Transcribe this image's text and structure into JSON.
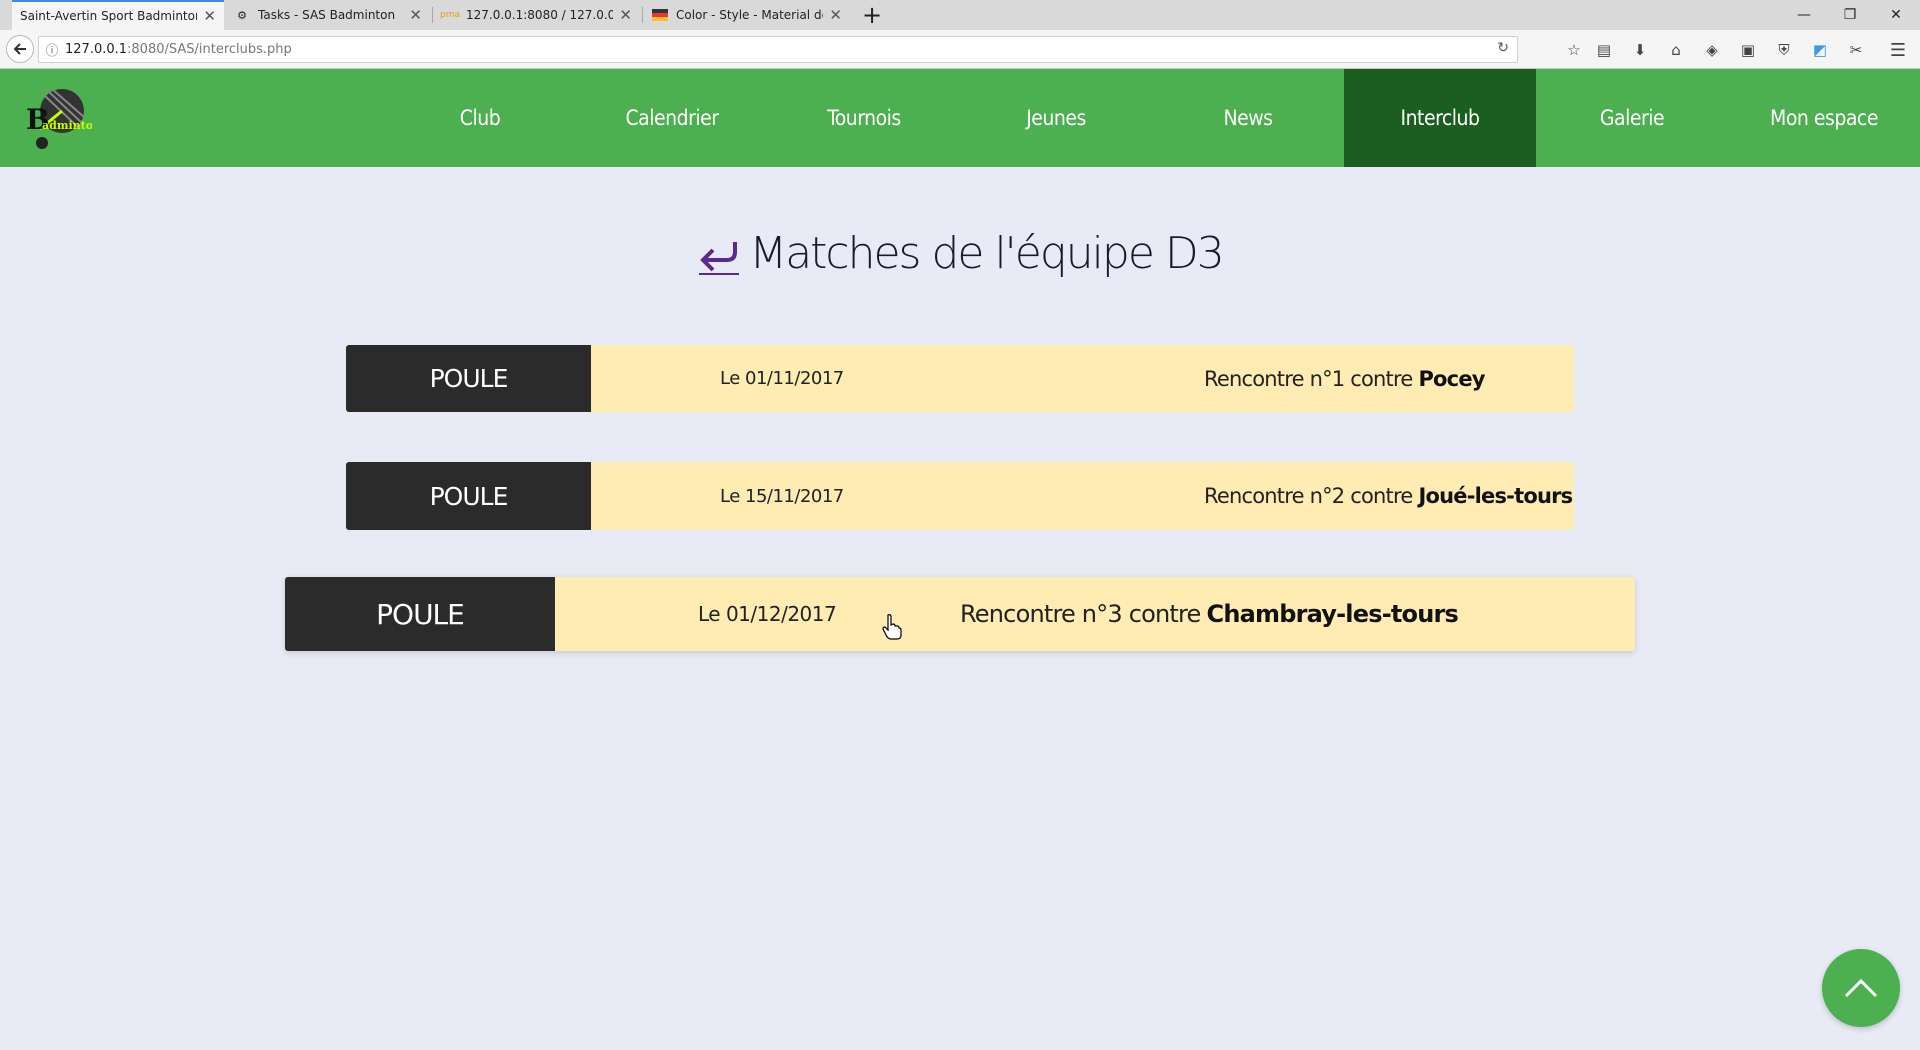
{
  "browser": {
    "tabs": [
      {
        "label": "Saint-Avertin Sport Badminton",
        "icon": "none"
      },
      {
        "label": "Tasks - SAS Badminton",
        "icon": "gear-icon"
      },
      {
        "label": "127.0.0.1:8080 / 127.0.0.1 / sa",
        "icon": "phpmyadmin-icon"
      },
      {
        "label": "Color - Style - Material desig",
        "icon": "material-icon"
      }
    ],
    "url": {
      "host": "127.0.0.1",
      "path": ":8080/SAS/interclubs.php"
    }
  },
  "nav": {
    "items": [
      "Club",
      "Calendrier",
      "Tournois",
      "Jeunes",
      "News",
      "Interclub",
      "Galerie",
      "Mon espace"
    ],
    "active": "Interclub"
  },
  "page": {
    "title": "Matches de l'équipe D3"
  },
  "matches": [
    {
      "phase": "POULE",
      "date": "Le 01/11/2017",
      "desc": "Rencontre n°1 contre",
      "opponent": "Pocey"
    },
    {
      "phase": "POULE",
      "date": "Le 15/11/2017",
      "desc": "Rencontre n°2 contre",
      "opponent": "Joué-les-tours"
    },
    {
      "phase": "POULE",
      "date": "Le 01/12/2017",
      "desc": "Rencontre n°3 contre",
      "opponent": "Chambray-les-tours"
    }
  ],
  "colors": {
    "header": "#4caf50",
    "active_nav": "#1b5e20",
    "background": "#e8eaf6",
    "phase_bg": "#2b2b2b",
    "match_bg": "#ffecb3",
    "back_arrow": "#5b2a8e"
  }
}
